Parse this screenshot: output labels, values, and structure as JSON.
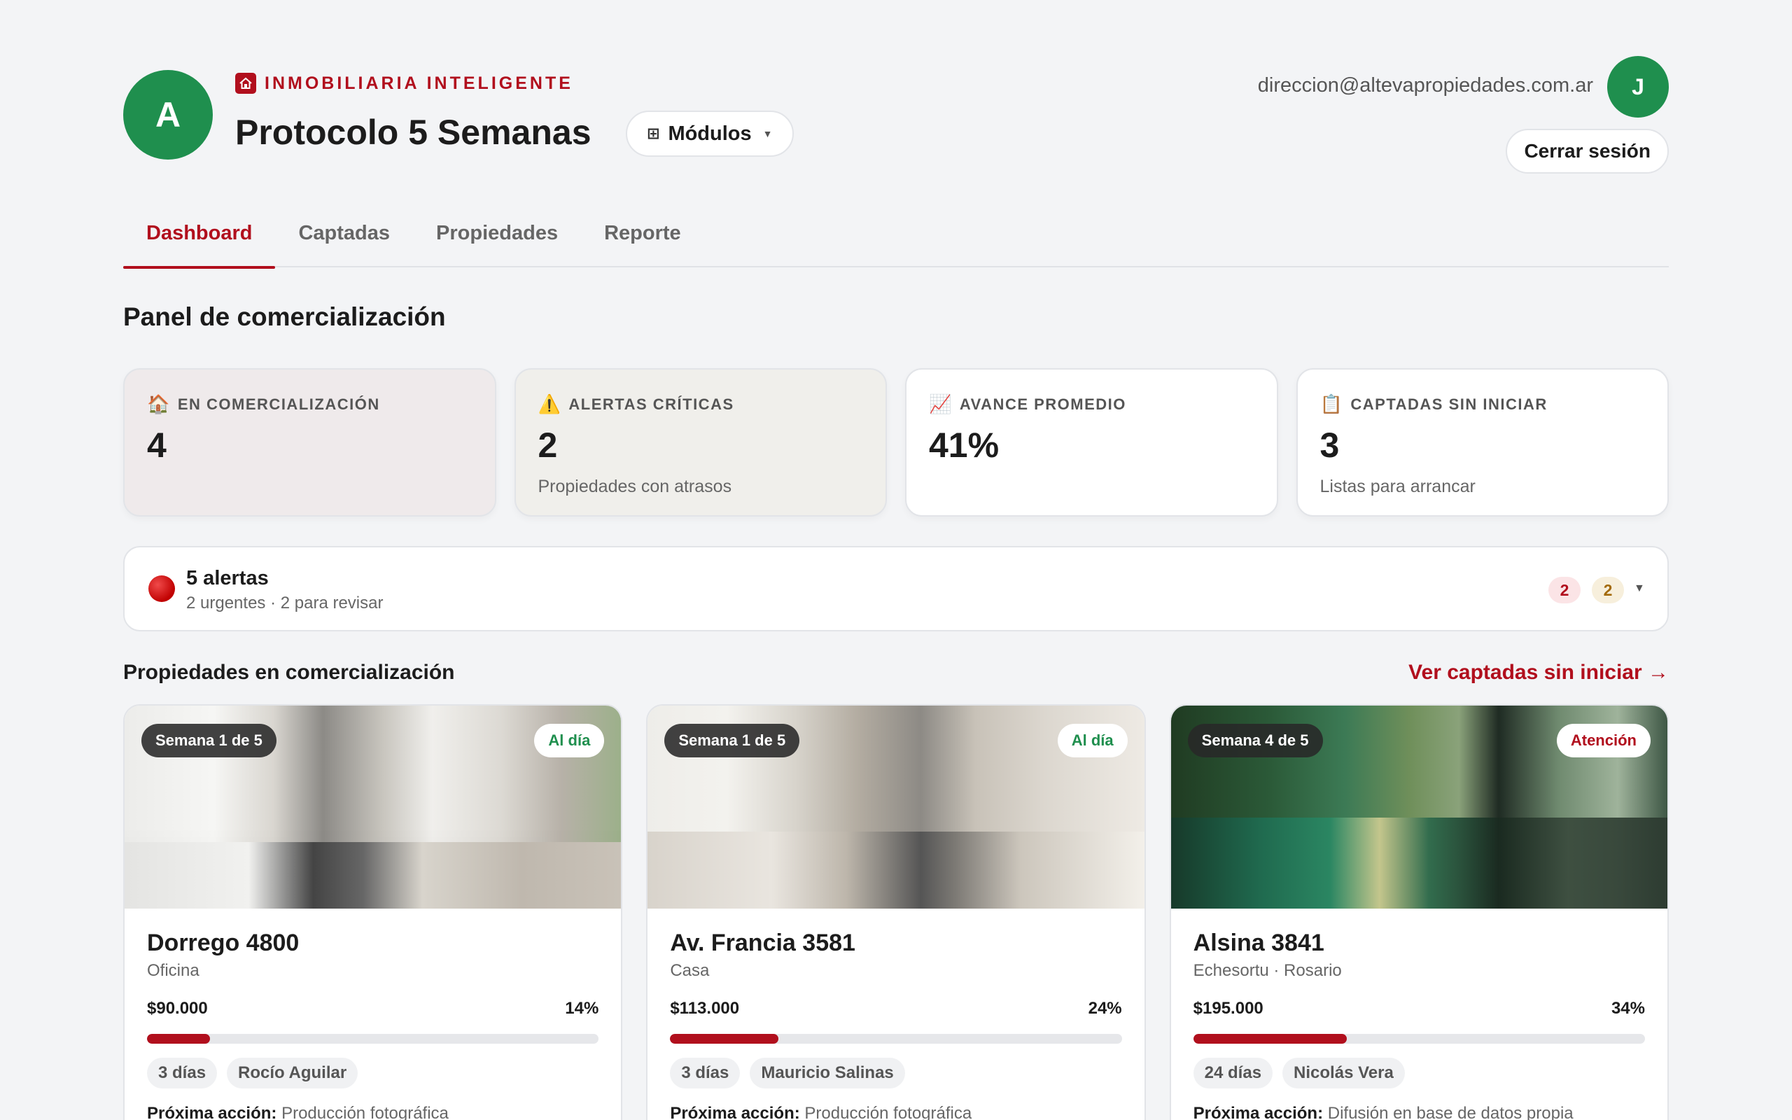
{
  "header": {
    "org_initial": "A",
    "brand": "INMOBILIARIA INTELIGENTE",
    "title": "Protocolo 5 Semanas",
    "modules_label": "Módulos",
    "user_email": "direccion@altevapropiedades.com.ar",
    "user_initial": "J",
    "logout_label": "Cerrar sesión"
  },
  "tabs": [
    {
      "label": "Dashboard",
      "active": true
    },
    {
      "label": "Captadas",
      "active": false
    },
    {
      "label": "Propiedades",
      "active": false
    },
    {
      "label": "Reporte",
      "active": false
    }
  ],
  "section_title": "Panel de comercialización",
  "stats": [
    {
      "icon": "house-icon",
      "label": "EN COMERCIALIZACIÓN",
      "value": "4",
      "sub": ""
    },
    {
      "icon": "warning-icon",
      "label": "ALERTAS CRÍTICAS",
      "value": "2",
      "sub": "Propiedades con atrasos"
    },
    {
      "icon": "chart-icon",
      "label": "AVANCE PROMEDIO",
      "value": "41%",
      "sub": ""
    },
    {
      "icon": "clipboard-icon",
      "label": "CAPTADAS SIN INICIAR",
      "value": "3",
      "sub": "Listas para arrancar"
    }
  ],
  "alerts": {
    "title": "5 alertas",
    "subtitle": "2 urgentes · 2 para revisar",
    "urgent_count": "2",
    "review_count": "2"
  },
  "properties_title": "Propiedades en comercialización",
  "properties_link": "Ver captadas sin iniciar →",
  "properties": [
    {
      "week": "Semana 1 de 5",
      "status": "Al día",
      "status_color": "#1f8f4e",
      "title": "Dorrego 4800",
      "type": "Oficina",
      "price": "$90.000",
      "progress_label": "14%",
      "progress": 14,
      "days": "3 días",
      "agent": "Rocío Aguilar",
      "next_action_label": "Próxima acción:",
      "next_action": "Producción fotográfica"
    },
    {
      "week": "Semana 1 de 5",
      "status": "Al día",
      "status_color": "#1f8f4e",
      "title": "Av. Francia 3581",
      "type": "Casa",
      "price": "$113.000",
      "progress_label": "24%",
      "progress": 24,
      "days": "3 días",
      "agent": "Mauricio Salinas",
      "next_action_label": "Próxima acción:",
      "next_action": "Producción fotográfica"
    },
    {
      "week": "Semana 4 de 5",
      "status": "Atención",
      "status_color": "#b10f1d",
      "title": "Alsina 3841",
      "type": "Echesortu · Rosario",
      "price": "$195.000",
      "progress_label": "34%",
      "progress": 34,
      "days": "24 días",
      "agent": "Nicolás Vera",
      "next_action_label": "Próxima acción:",
      "next_action": "Difusión en base de datos propia"
    }
  ],
  "colors": {
    "brand_red": "#b10f1d",
    "avatar_green": "#1f8f4e",
    "background": "#f3f4f6"
  }
}
